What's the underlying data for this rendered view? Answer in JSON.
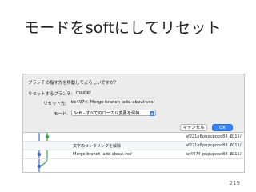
{
  "slide": {
    "title": "モードをsoftにしてリセット",
    "page_number": "219"
  },
  "dialog": {
    "question": "ブランチの指す先を移動してよろしいですか？",
    "branch_label": "リセットするブランチ:",
    "branch_value": "master",
    "target_label": "リセット先:",
    "target_value": "bc4974: Merge branch 'add-about-vcs'",
    "mode_label": "モード:",
    "mode_value": "Soft - すべてのローカル変更を保持",
    "cancel_label": "キャンセル",
    "ok_label": "OK"
  },
  "commits": [
    {
      "message": "",
      "sha": "af221e6",
      "author": "pupupopo88 <...",
      "date": "2015/"
    },
    {
      "message": "文字のセンタリングを解除",
      "sha": "af221e6",
      "author": "pupupopo88 <...",
      "date": "2015/"
    },
    {
      "message": "Merge branch 'add-about-vcs'",
      "sha": "bc4974",
      "author": "pupupopo88 <...",
      "date": "2015/"
    }
  ],
  "colors": {
    "accent": "#3b82f6",
    "graph_blue": "#3b6fd6",
    "graph_green": "#3aa35a"
  }
}
